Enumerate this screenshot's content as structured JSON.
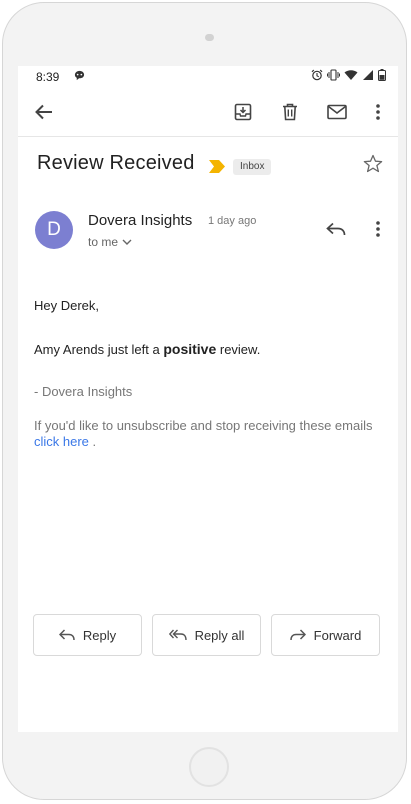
{
  "status_bar": {
    "time": "8:39",
    "icons": [
      "message-icon",
      "alarm-icon",
      "vibrate-icon",
      "wifi-icon",
      "signal-icon",
      "battery-icon"
    ]
  },
  "app_bar": {
    "icons": [
      "back-arrow-icon",
      "archive-icon",
      "trash-icon",
      "mail-icon",
      "more-vert-icon"
    ]
  },
  "email": {
    "subject": "Review Received",
    "label": "Inbox",
    "sender_initial": "D",
    "sender_name": "Dovera Insights",
    "time_ago": "1 day ago",
    "recipient": "to me",
    "greeting": "Hey Derek,",
    "line_before": "Amy Arends just left a ",
    "line_bold": "positive",
    "line_after": " review.",
    "signature": "- Dovera Insights",
    "unsubscribe_text": "If you'd like to unsubscribe and stop receiving these emails ",
    "unsubscribe_link": "click here",
    "unsubscribe_end": " ."
  },
  "actions": {
    "reply": "Reply",
    "reply_all": "Reply all",
    "forward": "Forward"
  },
  "colors": {
    "avatar": "#7c7fd1",
    "important_marker": "#f4b400",
    "link": "#3b78e7"
  }
}
